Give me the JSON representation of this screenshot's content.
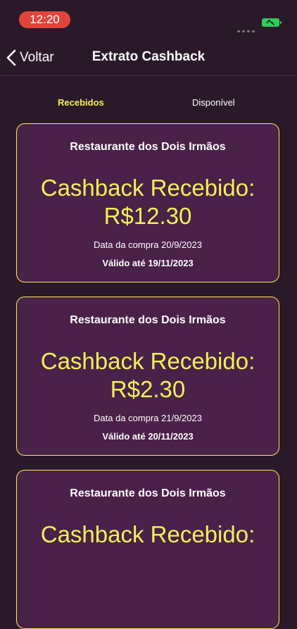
{
  "status_bar": {
    "time": "12:20"
  },
  "nav": {
    "back_label": "Voltar",
    "title": "Extrato Cashback"
  },
  "tabs": [
    {
      "label": "Recebidos",
      "selected": true
    },
    {
      "label": "Disponível",
      "selected": false
    }
  ],
  "cards": [
    {
      "store": "Restaurante dos Dois Irmãos",
      "heading": "Cashback Recebido:",
      "amount": "R$12.30",
      "purchase_date": "Data da compra 20/9/2023",
      "valid_until": "Válido até 19/11/2023"
    },
    {
      "store": "Restaurante dos Dois Irmãos",
      "heading": "Cashback Recebido:",
      "amount": "R$2.30",
      "purchase_date": "Data da compra 21/9/2023",
      "valid_until": "Válido até 20/11/2023"
    },
    {
      "store": "Restaurante dos Dois Irmãos",
      "heading": "Cashback Recebido:"
    }
  ],
  "colors": {
    "background": "#2a1a29",
    "card": "#4a2148",
    "accent": "#f5ef57"
  }
}
